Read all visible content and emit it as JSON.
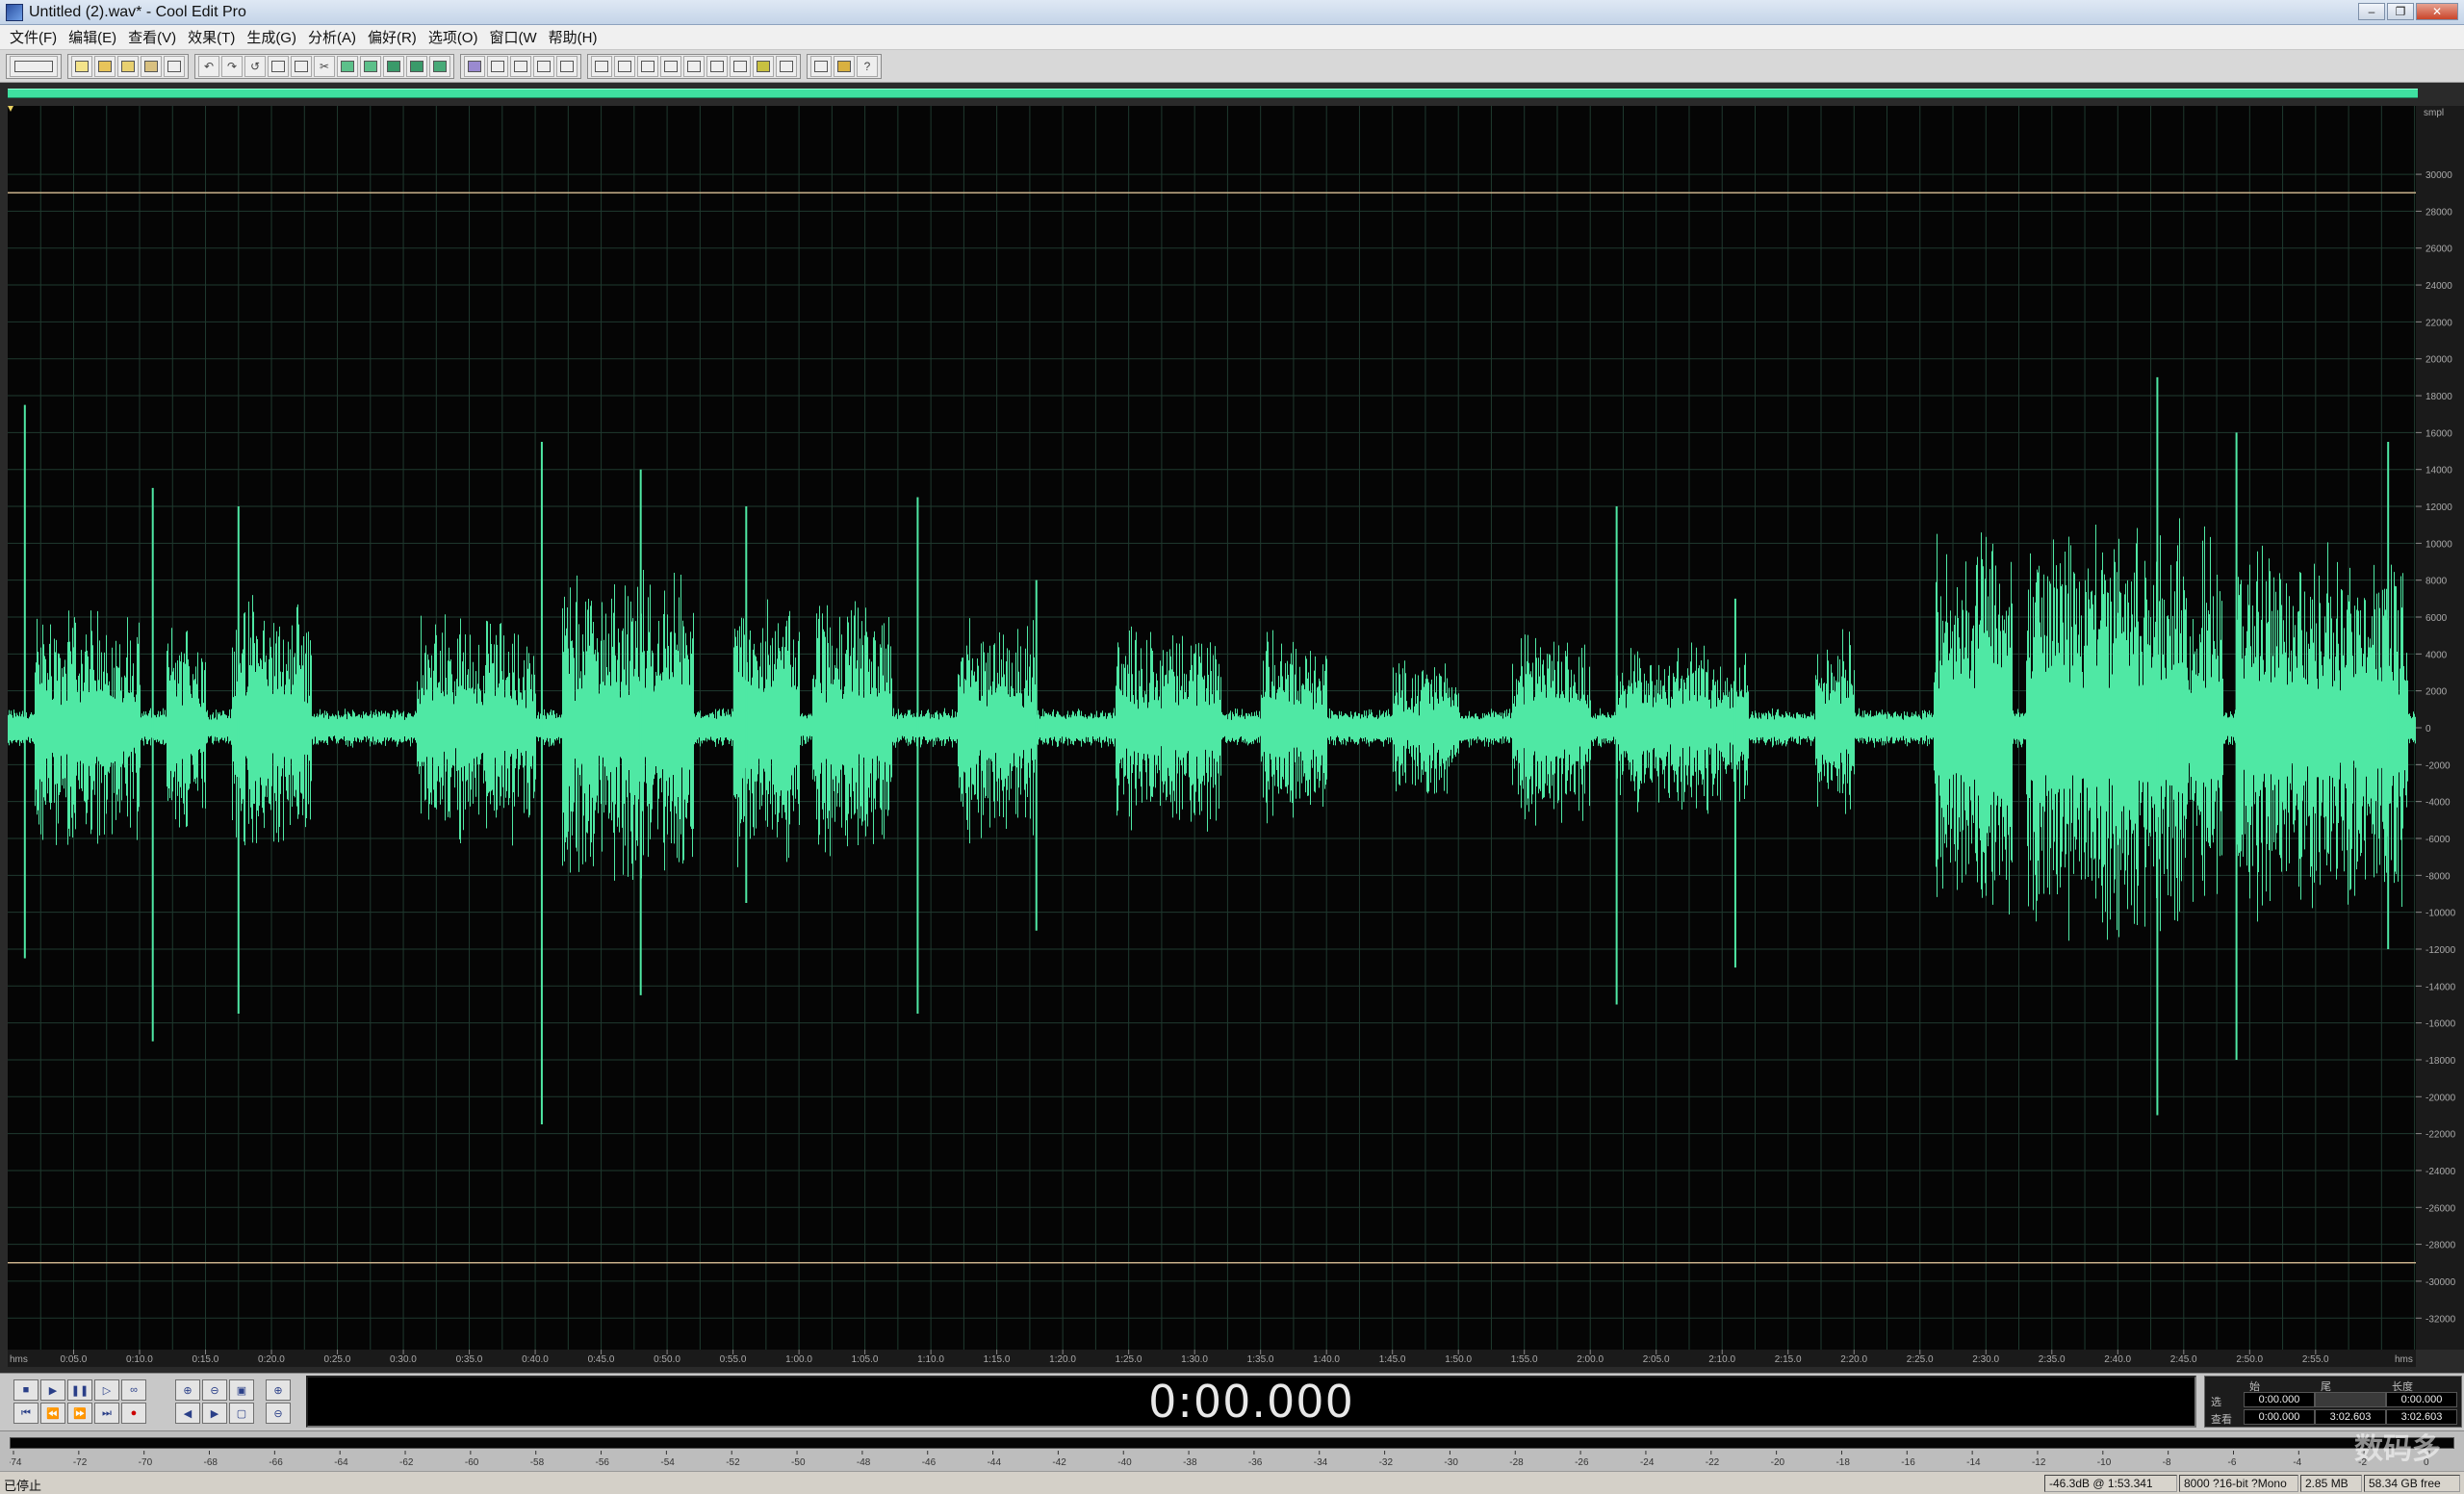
{
  "window": {
    "title": "Untitled (2).wav* - Cool Edit Pro"
  },
  "menu": [
    "文件(F)",
    "编辑(E)",
    "查看(V)",
    "效果(T)",
    "生成(G)",
    "分析(A)",
    "偏好(R)",
    "选项(O)",
    "窗口(W",
    "帮助(H)"
  ],
  "toolbar": {
    "button_count": 34
  },
  "waveform": {
    "color": "#4fe8a4",
    "background": "#050505",
    "grid_color": "#1f3a2f",
    "clip_line_color": "#c8b08a",
    "clip_levels": [
      29000,
      -29000
    ],
    "y_unit": "smpl",
    "y_ticks": [
      30000,
      28000,
      26000,
      24000,
      22000,
      20000,
      18000,
      16000,
      14000,
      12000,
      10000,
      8000,
      6000,
      4000,
      2000,
      0,
      -2000,
      -4000,
      -6000,
      -8000,
      -10000,
      -12000,
      -14000,
      -16000,
      -18000,
      -20000,
      -22000,
      -24000,
      -26000,
      -28000,
      -30000,
      -32000
    ],
    "x_unit": "hms",
    "x_ticks": [
      "0:05.0",
      "0:10.0",
      "0:15.0",
      "0:20.0",
      "0:25.0",
      "0:30.0",
      "0:35.0",
      "0:40.0",
      "0:45.0",
      "0:50.0",
      "0:55.0",
      "1:00.0",
      "1:05.0",
      "1:10.0",
      "1:15.0",
      "1:20.0",
      "1:25.0",
      "1:30.0",
      "1:35.0",
      "1:40.0",
      "1:45.0",
      "1:50.0",
      "1:55.0",
      "2:00.0",
      "2:05.0",
      "2:10.0",
      "2:15.0",
      "2:20.0",
      "2:25.0",
      "2:30.0",
      "2:35.0",
      "2:40.0",
      "2:45.0",
      "2:50.0",
      "2:55.0"
    ],
    "duration_s": 182.603
  },
  "transport": {
    "time": "0:00.000",
    "headers": {
      "start": "始",
      "end": "尾",
      "length": "长度"
    },
    "rows": [
      {
        "label": "选",
        "start": "0:00.000",
        "end": "",
        "length": "0:00.000"
      },
      {
        "label": "查看",
        "start": "0:00.000",
        "end": "3:02.603",
        "length": "3:02.603"
      }
    ]
  },
  "meter": {
    "ticks": [
      "-74",
      "-72",
      "-70",
      "-68",
      "-66",
      "-64",
      "-62",
      "-60",
      "-58",
      "-56",
      "-54",
      "-52",
      "-50",
      "-48",
      "-46",
      "-44",
      "-42",
      "-40",
      "-38",
      "-36",
      "-34",
      "-32",
      "-30",
      "-28",
      "-26",
      "-24",
      "-22",
      "-20",
      "-18",
      "-16",
      "-14",
      "-12",
      "-10",
      "-8",
      "-6",
      "-4",
      "-2",
      "0"
    ]
  },
  "status": {
    "state": "已停止",
    "level": "-46.3dB @ 1:53.341",
    "format": "8000 ?16-bit ?Mono",
    "size": "2.85 MB",
    "free": "58.34 GB free"
  },
  "watermark": "数码多"
}
